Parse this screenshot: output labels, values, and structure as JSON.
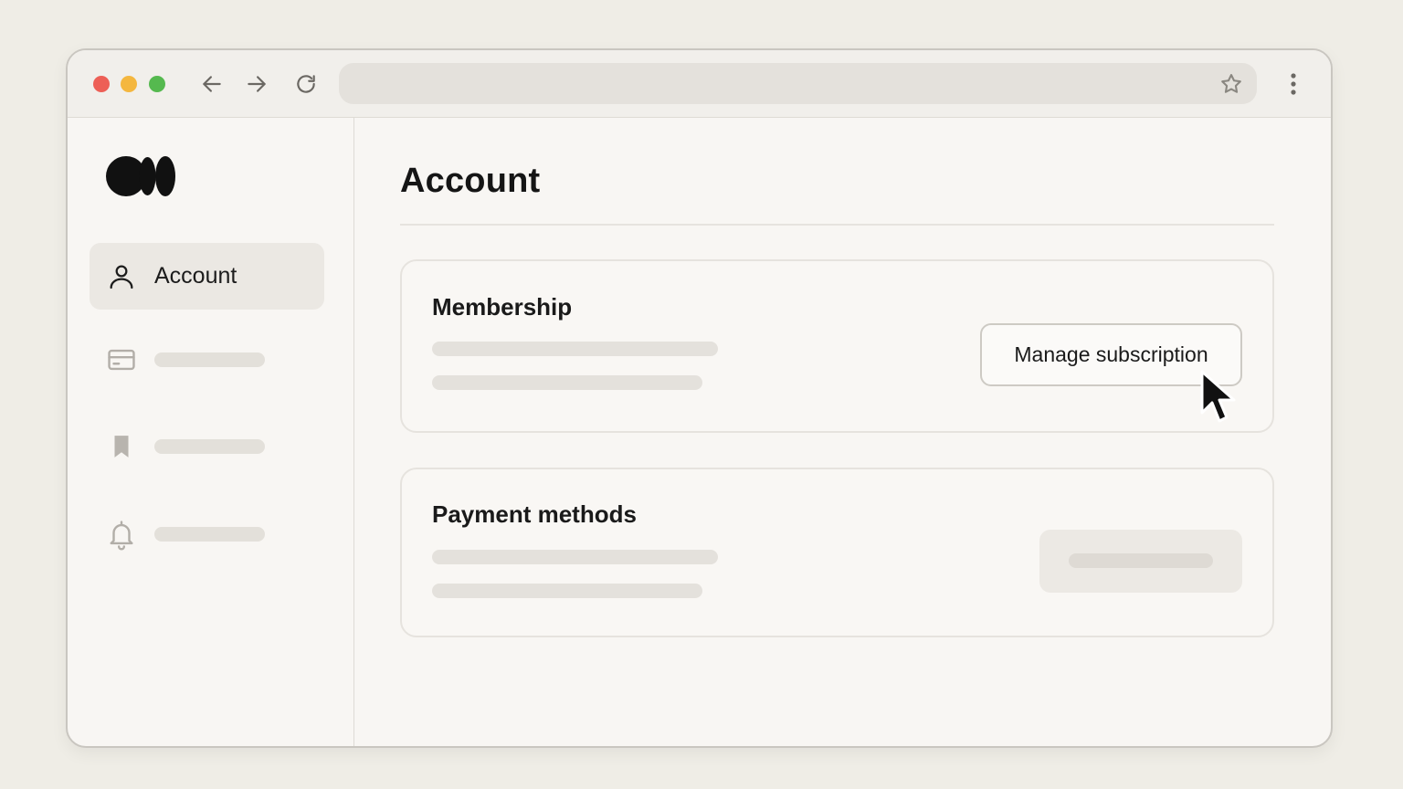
{
  "browser": {
    "traffic_lights": {
      "close_color": "#ed5f56",
      "minimize_color": "#f4b73f",
      "maximize_color": "#55b94f"
    },
    "address_bar": {
      "value": ""
    },
    "icons": [
      "arrow-left-icon",
      "arrow-right-icon",
      "reload-icon",
      "star-icon",
      "kebab-menu-icon"
    ]
  },
  "app": {
    "logo": "medium-logo"
  },
  "sidebar": {
    "items": [
      {
        "label": "Account",
        "icon": "user-icon",
        "active": true
      },
      {
        "label": "",
        "icon": "credit-card-icon",
        "active": false
      },
      {
        "label": "",
        "icon": "bookmark-icon",
        "active": false
      },
      {
        "label": "",
        "icon": "bell-icon",
        "active": false
      }
    ]
  },
  "main": {
    "title": "Account",
    "sections": [
      {
        "title": "Membership",
        "action_label": "Manage subscription"
      },
      {
        "title": "Payment methods",
        "action_label": ""
      }
    ]
  },
  "colors": {
    "background": "#efede6",
    "window": "#f8f6f3",
    "text": "#1a1a1a",
    "skeleton": "#e4e1dc"
  }
}
